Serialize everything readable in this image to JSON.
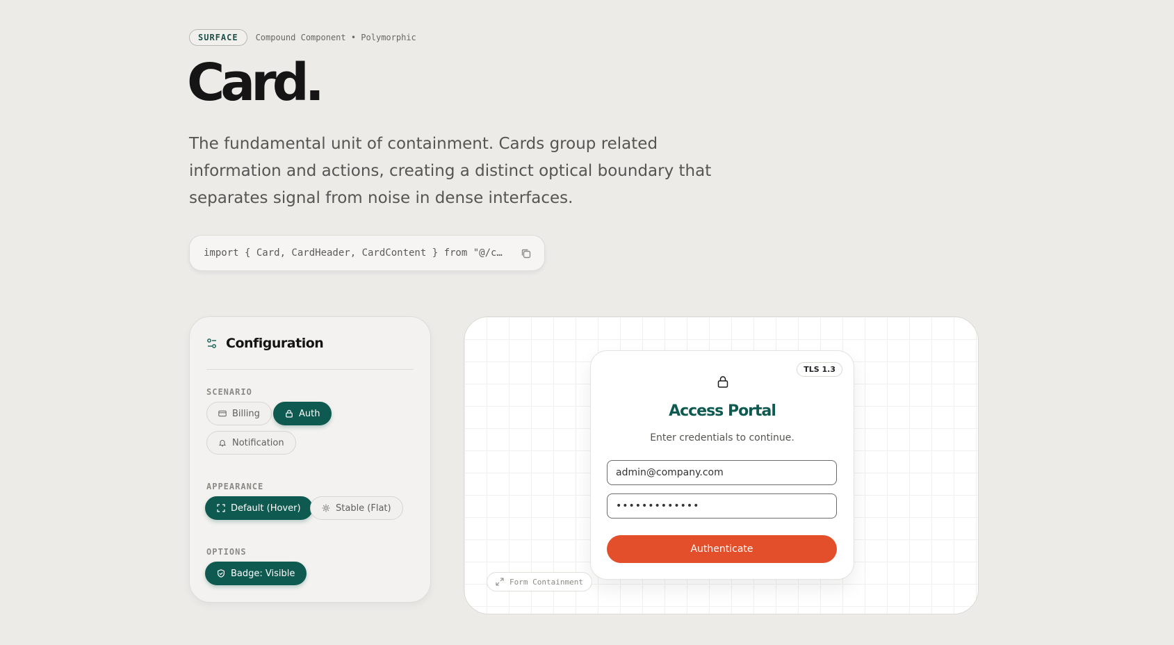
{
  "header": {
    "tag": "SURFACE",
    "subtitle": "Compound Component • Polymorphic",
    "title": "Card.",
    "lead": "The fundamental unit of containment. Cards group related information and actions, creating a distinct optical boundary that separates signal from noise in dense interfaces.",
    "code": "import { Card, CardHeader, CardContent } from \"@/c…"
  },
  "config": {
    "title": "Configuration",
    "scenario_label": "SCENARIO",
    "scenario_options": [
      {
        "label": "Billing",
        "icon": "card-icon",
        "selected": false
      },
      {
        "label": "Auth",
        "icon": "lock-icon",
        "selected": true
      },
      {
        "label": "Notification",
        "icon": "bell-icon",
        "selected": false
      }
    ],
    "appearance_label": "APPEARANCE",
    "appearance_options": [
      {
        "label": "Default (Hover)",
        "icon": "expand-icon",
        "selected": true
      },
      {
        "label": "Stable (Flat)",
        "icon": "settings-icon",
        "selected": false
      }
    ],
    "options_label": "OPTIONS",
    "options": [
      {
        "label": "Badge: Visible",
        "icon": "shield-check-icon",
        "selected": true
      }
    ]
  },
  "preview": {
    "badge": "TLS 1.3",
    "title": "Access Portal",
    "subtitle": "Enter credentials to continue.",
    "email_value": "admin@company.com",
    "password_value": "•••••••••••••",
    "submit_label": "Authenticate",
    "stage_label": "Form Containment"
  },
  "colors": {
    "accent": "#0f5a50",
    "cta": "#e34f2a",
    "background": "#ecebe8"
  }
}
